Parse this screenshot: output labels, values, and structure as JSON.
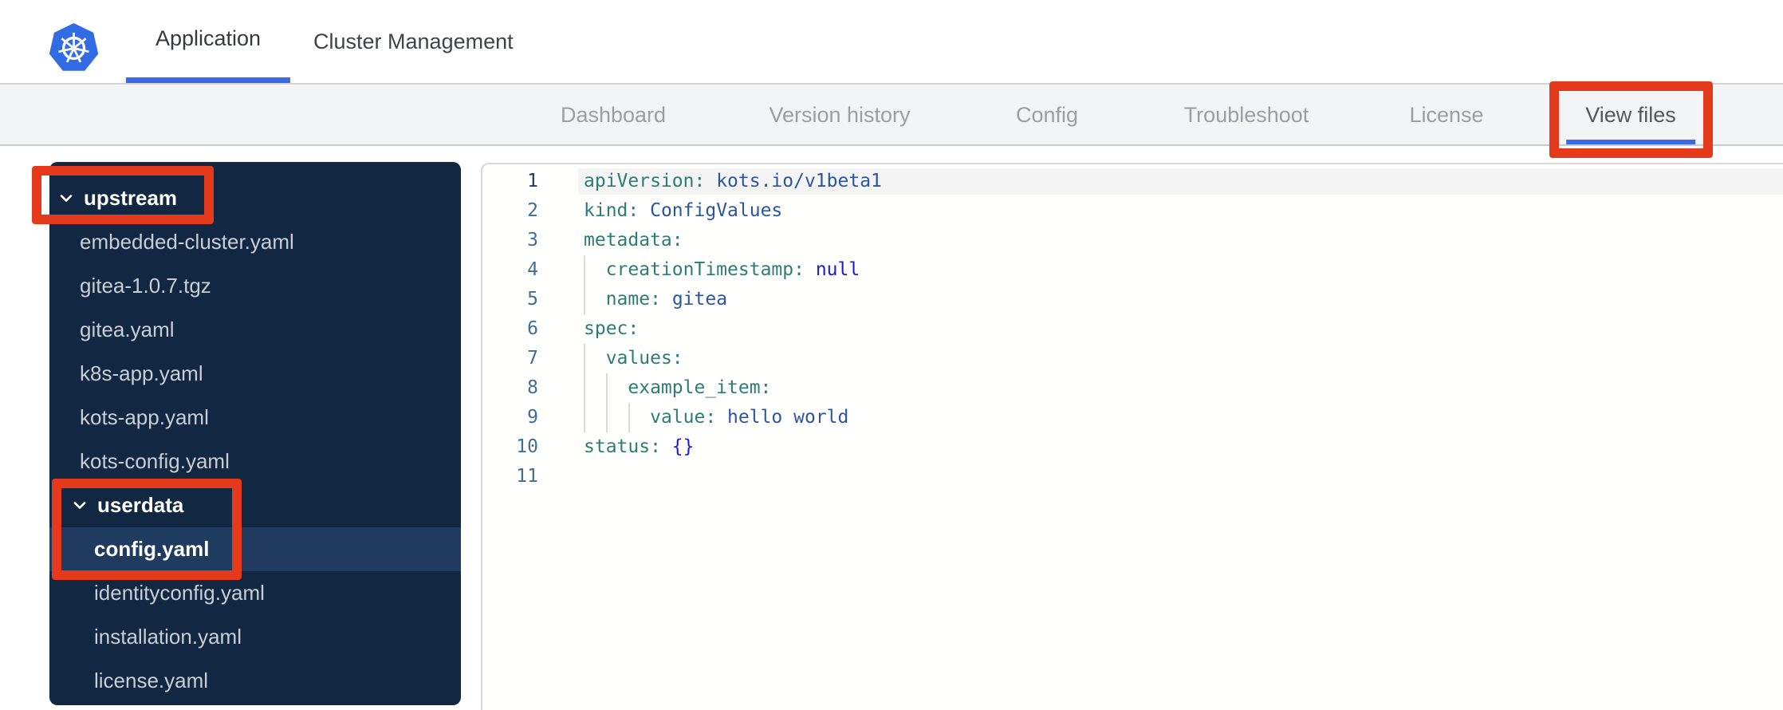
{
  "topbar": {
    "tabs": [
      {
        "label": "Application",
        "active": true
      },
      {
        "label": "Cluster Management",
        "active": false
      }
    ]
  },
  "nav": {
    "tabs": [
      {
        "label": "Dashboard",
        "active": false
      },
      {
        "label": "Version history",
        "active": false
      },
      {
        "label": "Config",
        "active": false
      },
      {
        "label": "Troubleshoot",
        "active": false
      },
      {
        "label": "License",
        "active": false
      },
      {
        "label": "View files",
        "active": true
      }
    ]
  },
  "file_tree": [
    {
      "kind": "folder",
      "label": "upstream",
      "indent": 0,
      "expanded": true
    },
    {
      "kind": "file",
      "label": "embedded-cluster.yaml",
      "indent": 0
    },
    {
      "kind": "file",
      "label": "gitea-1.0.7.tgz",
      "indent": 0
    },
    {
      "kind": "file",
      "label": "gitea.yaml",
      "indent": 0
    },
    {
      "kind": "file",
      "label": "k8s-app.yaml",
      "indent": 0
    },
    {
      "kind": "file",
      "label": "kots-app.yaml",
      "indent": 0
    },
    {
      "kind": "file",
      "label": "kots-config.yaml",
      "indent": 0
    },
    {
      "kind": "folder",
      "label": "userdata",
      "indent": 1,
      "expanded": true
    },
    {
      "kind": "file",
      "label": "config.yaml",
      "indent": 1,
      "selected": true
    },
    {
      "kind": "file",
      "label": "identityconfig.yaml",
      "indent": 1
    },
    {
      "kind": "file",
      "label": "installation.yaml",
      "indent": 1
    },
    {
      "kind": "file",
      "label": "license.yaml",
      "indent": 1
    }
  ],
  "editor": {
    "active_line": 1,
    "lines": [
      {
        "num": 1,
        "tokens": [
          [
            "k",
            "apiVersion:"
          ],
          [
            "p",
            " "
          ],
          [
            "v",
            "kots.io/v1beta1"
          ]
        ]
      },
      {
        "num": 2,
        "tokens": [
          [
            "k",
            "kind:"
          ],
          [
            "p",
            " "
          ],
          [
            "v",
            "ConfigValues"
          ]
        ]
      },
      {
        "num": 3,
        "tokens": [
          [
            "k",
            "metadata:"
          ]
        ]
      },
      {
        "num": 4,
        "tokens": [
          [
            "p",
            "  "
          ],
          [
            "k",
            "creationTimestamp:"
          ],
          [
            "p",
            " "
          ],
          [
            "kw",
            "null"
          ]
        ]
      },
      {
        "num": 5,
        "tokens": [
          [
            "p",
            "  "
          ],
          [
            "k",
            "name:"
          ],
          [
            "p",
            " "
          ],
          [
            "v",
            "gitea"
          ]
        ]
      },
      {
        "num": 6,
        "tokens": [
          [
            "k",
            "spec:"
          ]
        ]
      },
      {
        "num": 7,
        "tokens": [
          [
            "p",
            "  "
          ],
          [
            "k",
            "values:"
          ]
        ]
      },
      {
        "num": 8,
        "tokens": [
          [
            "p",
            "    "
          ],
          [
            "k",
            "example_item:"
          ]
        ]
      },
      {
        "num": 9,
        "tokens": [
          [
            "p",
            "      "
          ],
          [
            "k",
            "value:"
          ],
          [
            "p",
            " "
          ],
          [
            "v",
            "hello world"
          ]
        ]
      },
      {
        "num": 10,
        "tokens": [
          [
            "k",
            "status:"
          ],
          [
            "p",
            " "
          ],
          [
            "kw",
            "{}"
          ]
        ]
      },
      {
        "num": 11,
        "tokens": []
      }
    ]
  },
  "colors": {
    "annotation_red": "#e5391c",
    "accent_blue": "#386be5",
    "sidebar_bg": "#112742",
    "sidebar_selected_bg": "#1f3b60",
    "yaml_key": "#2e7d73",
    "yaml_value": "#2c55a0",
    "yaml_keyword": "#1b1bd1",
    "kubernetes_blue": "#326ce5"
  }
}
